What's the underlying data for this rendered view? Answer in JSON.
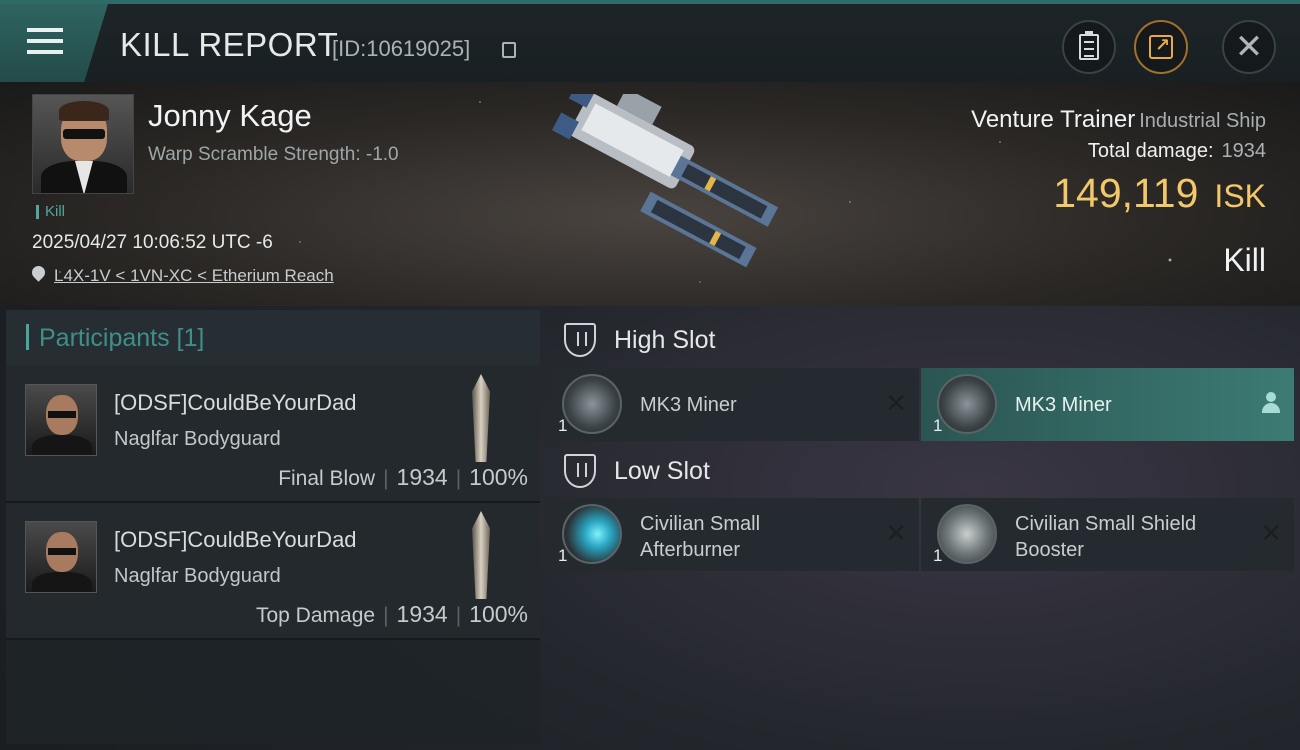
{
  "header": {
    "title": "KILL REPORT",
    "report_id": "[ID:10619025]"
  },
  "victim": {
    "name": "Jonny Kage",
    "warp_scramble": "Warp Scramble Strength: -1.0",
    "tag": "Kill",
    "datetime": "2025/04/27 10:06:52 UTC -6",
    "location": "L4X-1V < 1VN-XC < Etherium Reach",
    "ship_name": "Venture Trainer",
    "ship_class": "Industrial Ship",
    "total_damage_label": "Total damage:",
    "total_damage": "1934",
    "isk_value": "149,119",
    "isk_unit": "ISK",
    "result": "Kill"
  },
  "participants": {
    "header": "Participants [1]",
    "rows": [
      {
        "name": "[ODSF]CouldBeYourDad",
        "ship": "Naglfar Bodyguard",
        "role": "Final Blow",
        "damage": "1934",
        "percent": "100%"
      },
      {
        "name": "[ODSF]CouldBeYourDad",
        "ship": "Naglfar Bodyguard",
        "role": "Top Damage",
        "damage": "1934",
        "percent": "100%"
      }
    ]
  },
  "fitting": {
    "high_slot": {
      "title": "High Slot",
      "modules": [
        {
          "name": "MK3 Miner",
          "qty": "1",
          "icon": "miner-icon"
        },
        {
          "name": "MK3 Miner",
          "qty": "1",
          "icon": "miner-icon"
        }
      ]
    },
    "low_slot": {
      "title": "Low Slot",
      "modules": [
        {
          "name_line1": "Civilian Small",
          "name_line2": "Afterburner",
          "qty": "1",
          "icon": "afterburner-icon"
        },
        {
          "name_line1": "Civilian Small Shield",
          "name_line2": "Booster",
          "qty": "1",
          "icon": "shield-booster-icon"
        }
      ]
    }
  },
  "colors": {
    "accent": "#3c7b74",
    "isk": "#f3c86a",
    "participants_header": "#3f8f89"
  }
}
